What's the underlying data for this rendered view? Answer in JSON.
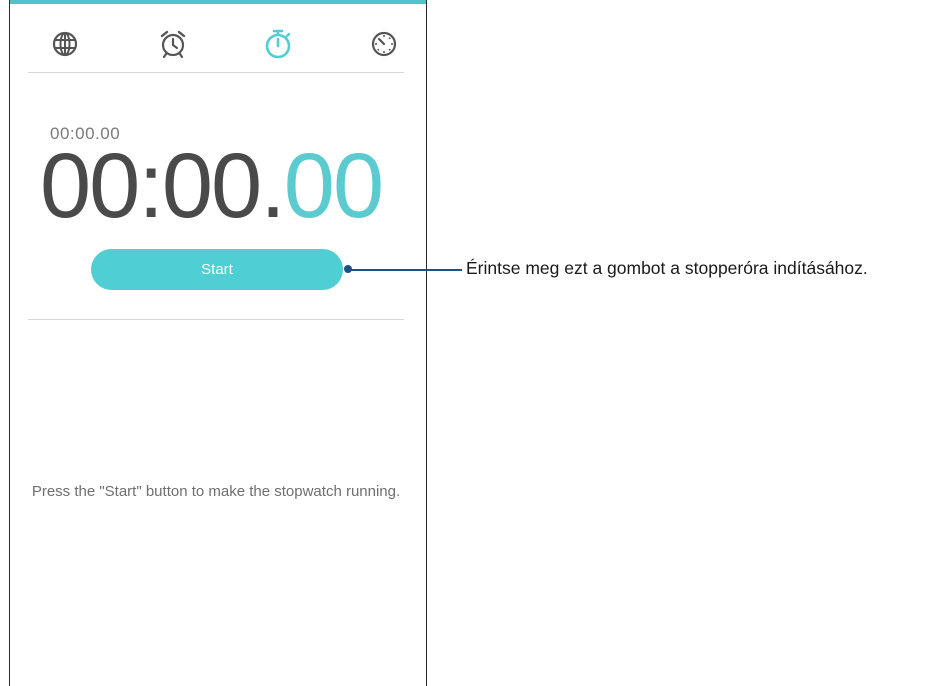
{
  "tabs": [
    {
      "name": "world-clock",
      "icon": "globe-icon",
      "active": false
    },
    {
      "name": "alarm",
      "icon": "alarm-clock-icon",
      "active": false
    },
    {
      "name": "stopwatch",
      "icon": "stopwatch-icon",
      "active": true
    },
    {
      "name": "timer",
      "icon": "timer-icon",
      "active": false
    }
  ],
  "stopwatch": {
    "lap_time": "00:00.00",
    "main_time": "00:00.",
    "centiseconds": "00",
    "start_label": "Start",
    "hint": "Press the \"Start\" button to make the stopwatch running."
  },
  "callout": {
    "text": "Érintse meg ezt a gombot a stopperóra indításához."
  },
  "colors": {
    "accent": "#4fcfd4",
    "icon_gray": "#555555",
    "callout_line": "#1e4f86"
  }
}
